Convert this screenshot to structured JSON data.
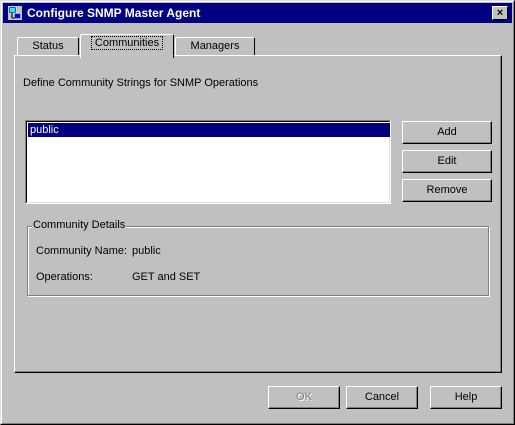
{
  "window": {
    "title": "Configure SNMP Master Agent",
    "close_glyph": "×"
  },
  "tabs": [
    {
      "label": "Status",
      "active": false
    },
    {
      "label": "Communities",
      "active": true
    },
    {
      "label": "Managers",
      "active": false
    }
  ],
  "panel": {
    "description": "Define Community Strings for SNMP Operations",
    "community_list": [
      "public"
    ],
    "selected_item": "public",
    "buttons": {
      "add": "Add",
      "edit": "Edit",
      "remove": "Remove"
    },
    "details": {
      "group_label": "Community Details",
      "name_label": "Community Name:",
      "name_value": "public",
      "ops_label": "Operations:",
      "ops_value": "GET and SET"
    }
  },
  "footer": {
    "ok": "OK",
    "cancel": "Cancel",
    "help": "Help"
  },
  "colors": {
    "titlebar": "#000080",
    "face": "#c0c0c0",
    "selection": "#000080"
  },
  "icons": {
    "app": "network-computer-icon",
    "close": "close-icon"
  }
}
